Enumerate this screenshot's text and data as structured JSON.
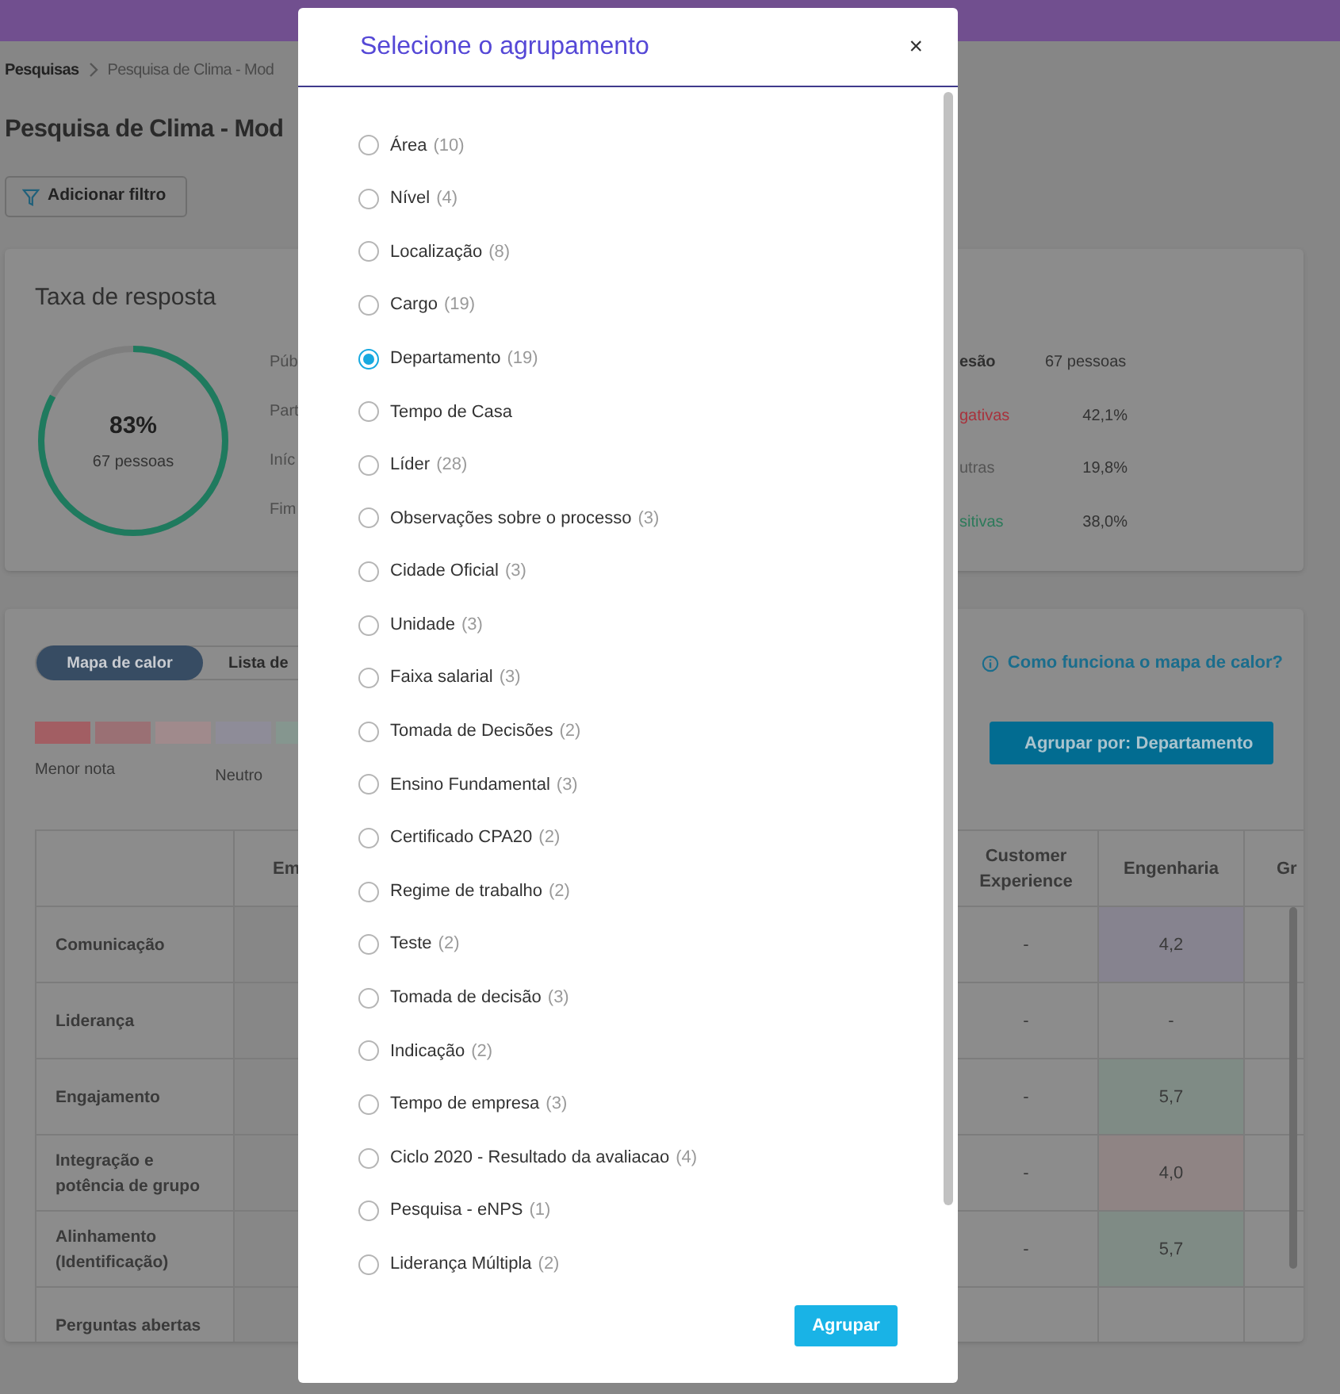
{
  "breadcrumb": [
    {
      "label": "Pesquisas"
    },
    {
      "label": "Pesquisa de Clima - Mod"
    }
  ],
  "page_title": "Pesquisa de Clima - Mod",
  "filter_button": "Adicionar filtro",
  "response_card": {
    "title": "Taxa de resposta",
    "percent": "83%",
    "people": "67 pessoas",
    "level": 0.83,
    "labels": [
      "Púb",
      "Part",
      "Iníc",
      "Fim"
    ],
    "stats": [
      {
        "label": "esão",
        "value": "67 pessoas",
        "color": "#2f2f2f"
      },
      {
        "label": "gativas",
        "value": "42,1%",
        "color": "#a8323c"
      },
      {
        "label": "utras",
        "value": "19,8%",
        "color": "#555555"
      },
      {
        "label": "sitivas",
        "value": "38,0%",
        "color": "#2c7a5a"
      }
    ]
  },
  "heatmap_card": {
    "tabs": [
      {
        "label": "Mapa de calor",
        "selected": true
      },
      {
        "label": "Lista de",
        "selected": false
      }
    ],
    "help_link": "Como funciona o mapa de calor?",
    "legend": {
      "swatches": [
        {
          "color": "#a25e63"
        },
        {
          "color": "#9a7074"
        },
        {
          "color": "#a08a8c"
        },
        {
          "color": "#8e8c98"
        },
        {
          "color": "#85968f"
        }
      ],
      "low_label": "Menor nota",
      "neutral_label": "Neutro"
    },
    "group_button": "Agrupar por: Departamento",
    "table": {
      "left_columns": [
        "Em"
      ],
      "right_columns": [
        "Customer Experience",
        "Engenharia",
        "Gr"
      ],
      "rows": [
        {
          "label": "Comunicação",
          "cells": [
            {
              "value": "-"
            },
            {
              "value": "4,2",
              "color": "#86838f"
            }
          ]
        },
        {
          "label": "Liderança",
          "cells": [
            {
              "value": "-"
            },
            {
              "value": "-"
            }
          ]
        },
        {
          "label": "Engajamento",
          "cells": [
            {
              "value": "-"
            },
            {
              "value": "5,7",
              "color": "#7f8b85"
            }
          ]
        },
        {
          "label": "Integração e potência de grupo",
          "cells": [
            {
              "value": "-"
            },
            {
              "value": "4,0",
              "color": "#8f8484"
            }
          ]
        },
        {
          "label": "Alinhamento (Identificação)",
          "cells": [
            {
              "value": "-"
            },
            {
              "value": "5,7",
              "color": "#7f8b85"
            }
          ]
        },
        {
          "label": "Perguntas abertas"
        }
      ]
    }
  },
  "modal": {
    "title": "Selecione o agrupamento",
    "close": "×",
    "options": [
      {
        "label": "Área",
        "count": "(10)",
        "selected": false
      },
      {
        "label": "Nível",
        "count": "(4)",
        "selected": false
      },
      {
        "label": "Localização",
        "count": "(8)",
        "selected": false
      },
      {
        "label": "Cargo",
        "count": "(19)",
        "selected": false
      },
      {
        "label": "Departamento",
        "count": "(19)",
        "selected": true
      },
      {
        "label": "Tempo de Casa",
        "selected": false
      },
      {
        "label": "Líder",
        "count": "(28)",
        "selected": false
      },
      {
        "label": "Observações sobre o processo",
        "count": "(3)",
        "selected": false
      },
      {
        "label": "Cidade Oficial",
        "count": "(3)",
        "selected": false
      },
      {
        "label": "Unidade",
        "count": "(3)",
        "selected": false
      },
      {
        "label": "Faixa salarial",
        "count": "(3)",
        "selected": false
      },
      {
        "label": "Tomada de Decisões",
        "count": "(2)",
        "selected": false
      },
      {
        "label": "Ensino Fundamental",
        "count": "(3)",
        "selected": false
      },
      {
        "label": "Certificado CPA20",
        "count": "(2)",
        "selected": false
      },
      {
        "label": "Regime de trabalho",
        "count": "(2)",
        "selected": false
      },
      {
        "label": "Teste",
        "count": "(2)",
        "selected": false
      },
      {
        "label": "Tomada de decisão",
        "count": "(3)",
        "selected": false
      },
      {
        "label": "Indicação",
        "count": "(2)",
        "selected": false
      },
      {
        "label": "Tempo de empresa",
        "count": "(3)",
        "selected": false
      },
      {
        "label": "Ciclo 2020 - Resultado da avaliacao",
        "count": "(4)",
        "selected": false
      },
      {
        "label": "Pesquisa - eNPS",
        "count": "(1)",
        "selected": false
      },
      {
        "label": "Liderança Múltipla",
        "count": "(2)",
        "selected": false
      }
    ],
    "submit_button": "Agrupar"
  }
}
